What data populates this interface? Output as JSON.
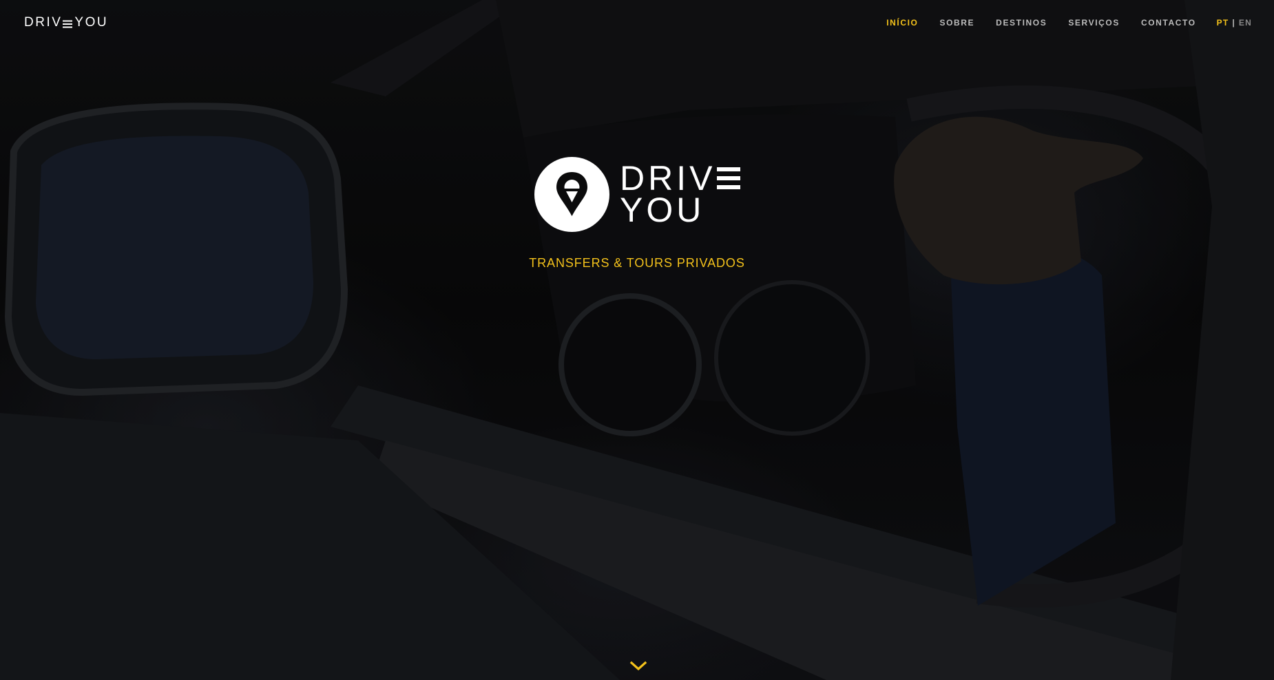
{
  "brand": {
    "left": "DRIV",
    "right": "YOU",
    "logo_top": "DRIV",
    "logo_bottom": "YOU"
  },
  "nav": {
    "items": [
      {
        "label": "INÍCIO",
        "active": true
      },
      {
        "label": "SOBRE",
        "active": false
      },
      {
        "label": "DESTINOS",
        "active": false
      },
      {
        "label": "SERVIÇOS",
        "active": false
      },
      {
        "label": "CONTACTO",
        "active": false
      }
    ],
    "lang": {
      "pt": "PT",
      "separator": "|",
      "en": "EN"
    }
  },
  "hero": {
    "tagline": "TRANSFERS & TOURS PRIVADOS"
  },
  "icons": {
    "logo": "location-pin-icon",
    "scroll": "chevron-down-icon"
  },
  "colors": {
    "accent": "#f4c21b",
    "nav_text": "#bdbdbd",
    "brand_text": "#ffffff",
    "background": "#0b0b0c"
  }
}
